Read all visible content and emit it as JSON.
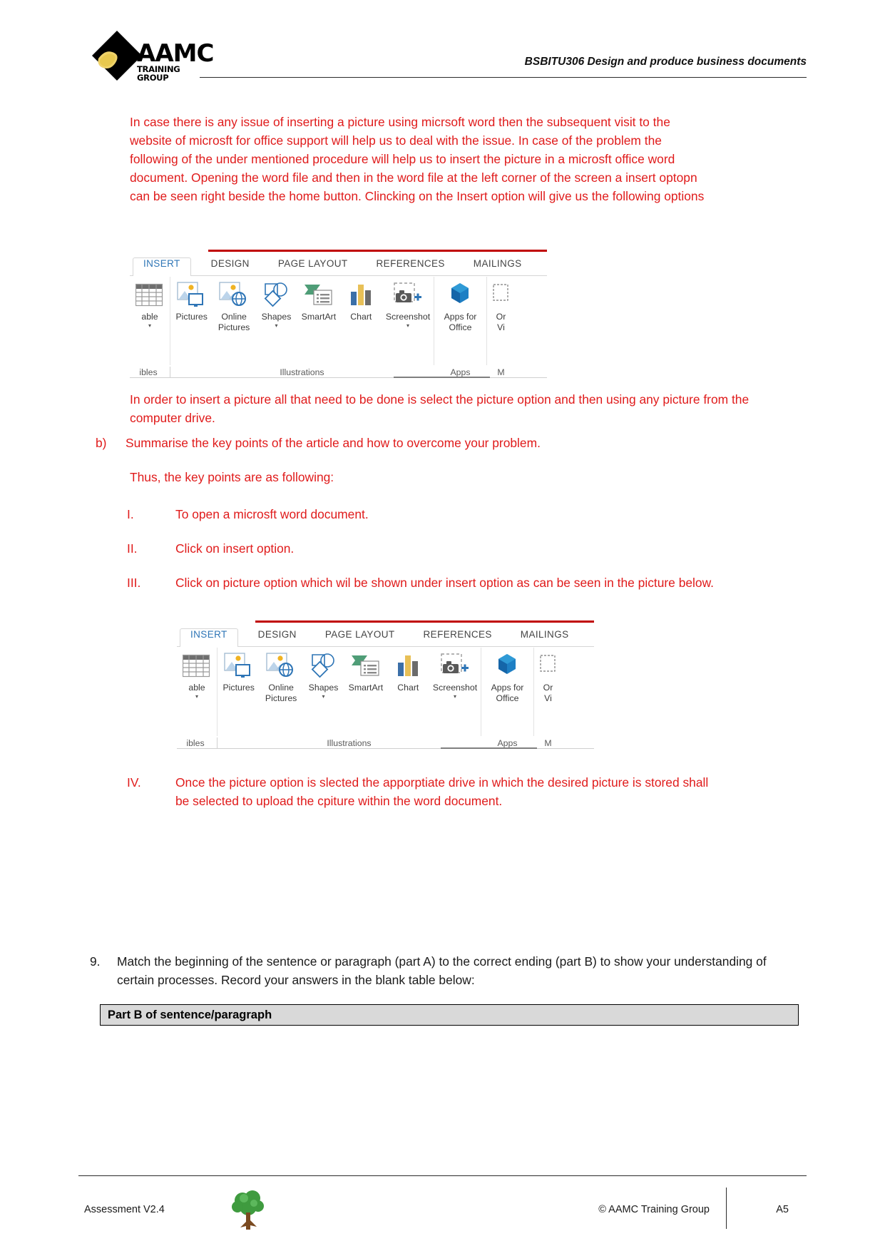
{
  "header": {
    "logo_main": "AAMC",
    "logo_sub": "TRAINING GROUP",
    "title": "BSBITU306 Design and produce business documents"
  },
  "content": {
    "intro_paragraph": "In case there is any issue of inserting a picture using micrsoft word then the subsequent visit to the website of microsft for office support will help us to deal with the issue. In case of the problem the following of the under mentioned procedure will help us to insert the picture in a microsft office word document. Opening the word file and then in the word file at the left corner of the screen a insert optopn can be seen right beside the home button. Clincking on the Insert option will give us the following options",
    "after_ribbon_paragraph": "In order to insert a picture all that need to be done is select the picture option and then using any picture from the computer drive.",
    "item_b_marker": "b)",
    "item_b_text": "Summarise the key points of the article and how to overcome your problem.",
    "thus_line": "Thus, the key points are as following:",
    "roman_items": [
      {
        "marker": "I.",
        "text": "To open a microsft word document."
      },
      {
        "marker": "II.",
        "text": "Click on insert option."
      },
      {
        "marker": "III.",
        "text": "Click on picture option which wil be shown under insert option as can be seen in the picture below."
      },
      {
        "marker": "IV.",
        "text": "Once the picture option is slected the apporptiate drive in which the desired picture is stored shall be selected to upload the cpiture within the word document."
      }
    ]
  },
  "ribbon": {
    "tabs": [
      "INSERT",
      "DESIGN",
      "PAGE LAYOUT",
      "REFERENCES",
      "MAILINGS"
    ],
    "active_tab": "INSERT",
    "accent_color": "#c00000",
    "active_tab_color": "#2e75b6",
    "buttons": [
      {
        "label": "able",
        "icon": "table-icon",
        "caret": true
      },
      {
        "label": "Pictures",
        "icon": "pictures-icon",
        "caret": false
      },
      {
        "label": "Online\nPictures",
        "icon": "online-pictures-icon",
        "caret": false
      },
      {
        "label": "Shapes",
        "icon": "shapes-icon",
        "caret": true
      },
      {
        "label": "SmartArt",
        "icon": "smartart-icon",
        "caret": false
      },
      {
        "label": "Chart",
        "icon": "chart-icon",
        "caret": false
      },
      {
        "label": "Screenshot",
        "icon": "screenshot-icon",
        "caret": true
      },
      {
        "label": "Apps for\nOffice",
        "icon": "apps-for-office-icon",
        "caret": true
      },
      {
        "label": "Or\nVi",
        "icon": "online-video-icon",
        "caret": false
      }
    ],
    "group_labels": [
      "ibles",
      "Illustrations",
      "Apps",
      "M"
    ]
  },
  "question9": {
    "marker": "9.",
    "text": "Match the beginning of the sentence or paragraph (part A) to the correct ending (part B) to show your understanding of certain processes. Record your answers in the blank table below:",
    "table_header": "Part B of sentence/paragraph"
  },
  "footer": {
    "left": "Assessment V2.4",
    "copyright": "© AAMC Training Group",
    "page": "A5"
  }
}
